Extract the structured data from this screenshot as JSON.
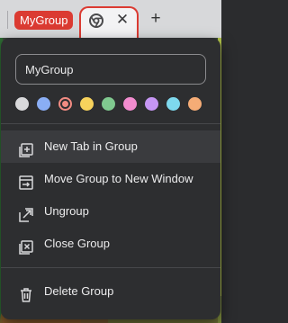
{
  "tab_strip": {
    "group_label": "MyGroup",
    "group_color": "#db3b32",
    "active_tab_favicon": "chrome-icon",
    "close_glyph": "✕",
    "new_tab_glyph": "+"
  },
  "menu": {
    "group_name_value": "MyGroup",
    "colors": [
      {
        "name": "grey",
        "hex": "#d9d9db",
        "selected": false
      },
      {
        "name": "blue",
        "hex": "#8aaef5",
        "selected": false
      },
      {
        "name": "red",
        "hex": "#f28b82",
        "selected": true
      },
      {
        "name": "yellow",
        "hex": "#f7d25c",
        "selected": false
      },
      {
        "name": "green",
        "hex": "#80c98f",
        "selected": false
      },
      {
        "name": "pink",
        "hex": "#f28ccf",
        "selected": false
      },
      {
        "name": "purple",
        "hex": "#c696f4",
        "selected": false
      },
      {
        "name": "cyan",
        "hex": "#7ed9ee",
        "selected": false
      },
      {
        "name": "orange",
        "hex": "#f5ac76",
        "selected": false
      }
    ],
    "items": [
      {
        "label": "New Tab in Group",
        "icon": "new-tab-in-group-icon"
      },
      {
        "label": "Move Group to New Window",
        "icon": "move-to-window-icon"
      },
      {
        "label": "Ungroup",
        "icon": "ungroup-icon"
      },
      {
        "label": "Close Group",
        "icon": "close-group-icon"
      },
      {
        "label": "Delete Group",
        "icon": "trash-icon"
      }
    ]
  }
}
